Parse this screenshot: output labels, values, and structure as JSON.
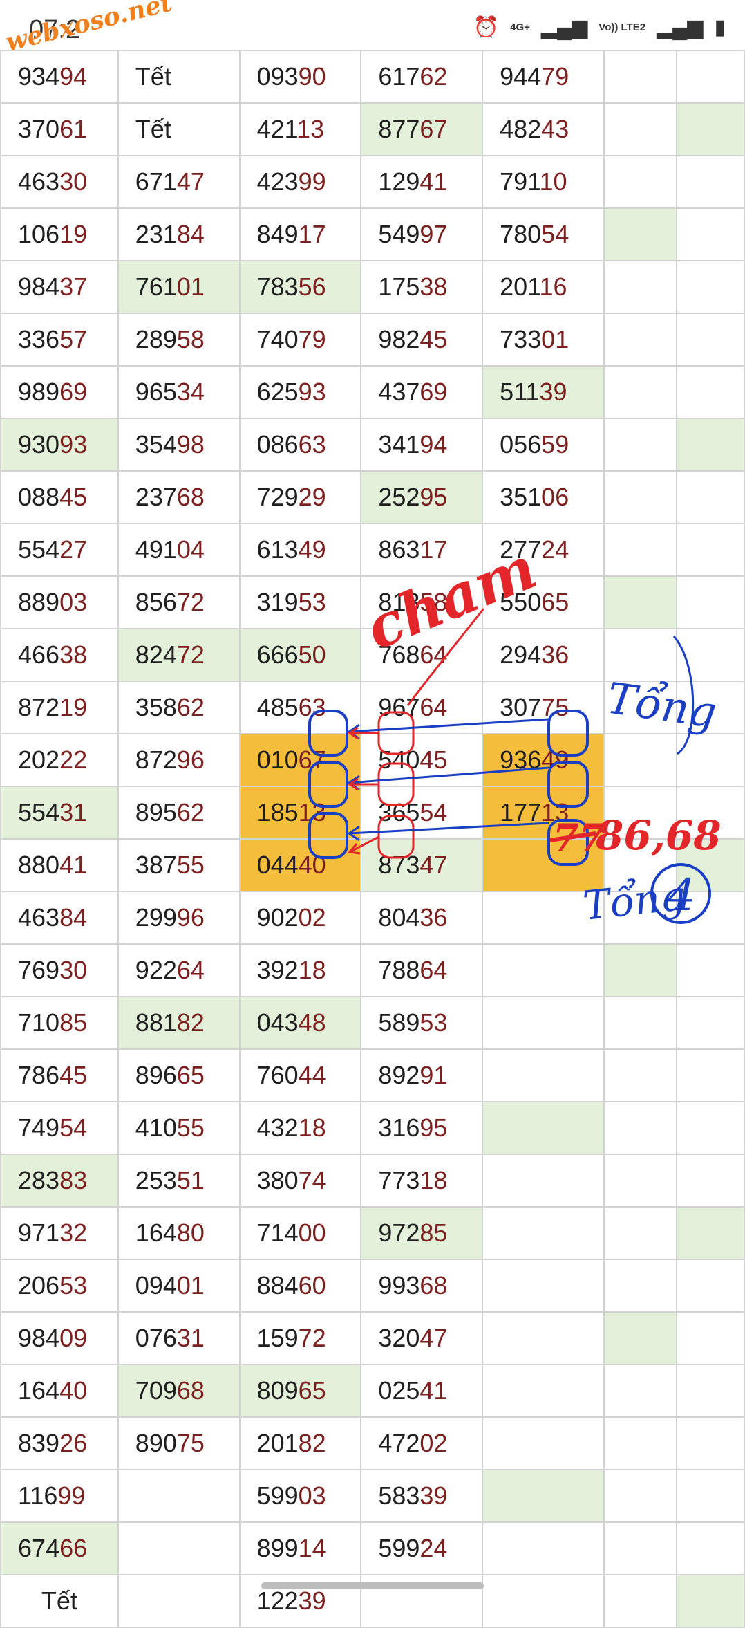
{
  "status": {
    "time": "07:2",
    "net": "4G+",
    "volte": "Vo)) LTE2"
  },
  "watermark": "webxoso.net",
  "table": {
    "rows": [
      [
        {
          "t": "93494",
          "p": "934",
          "s": "94"
        },
        {
          "t": "Tết"
        },
        {
          "t": "09390",
          "p": "093",
          "s": "90"
        },
        {
          "t": "61762",
          "p": "617",
          "s": "62"
        },
        {
          "t": "94479",
          "p": "944",
          "s": "79"
        },
        {
          "t": ""
        },
        {
          "t": ""
        }
      ],
      [
        {
          "t": "37061",
          "p": "370",
          "s": "61"
        },
        {
          "t": "Tết"
        },
        {
          "t": "42113",
          "p": "421",
          "s": "13"
        },
        {
          "t": "87767",
          "p": "877",
          "s": "67",
          "bg": "green"
        },
        {
          "t": "48243",
          "p": "482",
          "s": "43"
        },
        {
          "t": ""
        },
        {
          "t": "",
          "bg": "green"
        }
      ],
      [
        {
          "t": "46330",
          "p": "463",
          "s": "30"
        },
        {
          "t": "67147",
          "p": "671",
          "s": "47"
        },
        {
          "t": "42399",
          "p": "423",
          "s": "99"
        },
        {
          "t": "12941",
          "p": "129",
          "s": "41"
        },
        {
          "t": "79110",
          "p": "791",
          "s": "10"
        },
        {
          "t": ""
        },
        {
          "t": ""
        }
      ],
      [
        {
          "t": "10619",
          "p": "106",
          "s": "19"
        },
        {
          "t": "23184",
          "p": "231",
          "s": "84"
        },
        {
          "t": "84917",
          "p": "849",
          "s": "17"
        },
        {
          "t": "54997",
          "p": "549",
          "s": "97"
        },
        {
          "t": "78054",
          "p": "780",
          "s": "54"
        },
        {
          "t": "",
          "bg": "green"
        },
        {
          "t": ""
        }
      ],
      [
        {
          "t": "98437",
          "p": "984",
          "s": "37"
        },
        {
          "t": "76101",
          "p": "761",
          "s": "01",
          "bg": "green"
        },
        {
          "t": "78356",
          "p": "783",
          "s": "56",
          "bg": "green"
        },
        {
          "t": "17538",
          "p": "175",
          "s": "38"
        },
        {
          "t": "20116",
          "p": "201",
          "s": "16"
        },
        {
          "t": ""
        },
        {
          "t": ""
        }
      ],
      [
        {
          "t": "33657",
          "p": "336",
          "s": "57"
        },
        {
          "t": "28958",
          "p": "289",
          "s": "58"
        },
        {
          "t": "74079",
          "p": "740",
          "s": "79"
        },
        {
          "t": "98245",
          "p": "982",
          "s": "45"
        },
        {
          "t": "73301",
          "p": "733",
          "s": "01"
        },
        {
          "t": ""
        },
        {
          "t": ""
        }
      ],
      [
        {
          "t": "98969",
          "p": "989",
          "s": "69"
        },
        {
          "t": "96534",
          "p": "965",
          "s": "34"
        },
        {
          "t": "62593",
          "p": "625",
          "s": "93"
        },
        {
          "t": "43769",
          "p": "437",
          "s": "69"
        },
        {
          "t": "51139",
          "p": "511",
          "s": "39",
          "bg": "green"
        },
        {
          "t": ""
        },
        {
          "t": ""
        }
      ],
      [
        {
          "t": "93093",
          "p": "930",
          "s": "93",
          "bg": "green"
        },
        {
          "t": "35498",
          "p": "354",
          "s": "98"
        },
        {
          "t": "08663",
          "p": "086",
          "s": "63"
        },
        {
          "t": "34194",
          "p": "341",
          "s": "94"
        },
        {
          "t": "05659",
          "p": "056",
          "s": "59"
        },
        {
          "t": ""
        },
        {
          "t": "",
          "bg": "green"
        }
      ],
      [
        {
          "t": "08845",
          "p": "088",
          "s": "45"
        },
        {
          "t": "23768",
          "p": "237",
          "s": "68"
        },
        {
          "t": "72929",
          "p": "729",
          "s": "29"
        },
        {
          "t": "25295",
          "p": "252",
          "s": "95",
          "bg": "green"
        },
        {
          "t": "35106",
          "p": "351",
          "s": "06"
        },
        {
          "t": ""
        },
        {
          "t": ""
        }
      ],
      [
        {
          "t": "55427",
          "p": "554",
          "s": "27"
        },
        {
          "t": "49104",
          "p": "491",
          "s": "04"
        },
        {
          "t": "61349",
          "p": "613",
          "s": "49"
        },
        {
          "t": "86317",
          "p": "863",
          "s": "17"
        },
        {
          "t": "27724",
          "p": "277",
          "s": "24"
        },
        {
          "t": ""
        },
        {
          "t": ""
        }
      ],
      [
        {
          "t": "88903",
          "p": "889",
          "s": "03"
        },
        {
          "t": "85672",
          "p": "856",
          "s": "72"
        },
        {
          "t": "31953",
          "p": "319",
          "s": "53"
        },
        {
          "t": "81358",
          "p": "813",
          "s": "58"
        },
        {
          "t": "55065",
          "p": "550",
          "s": "65"
        },
        {
          "t": "",
          "bg": "green"
        },
        {
          "t": ""
        }
      ],
      [
        {
          "t": "46638",
          "p": "466",
          "s": "38"
        },
        {
          "t": "82472",
          "p": "824",
          "s": "72",
          "bg": "green"
        },
        {
          "t": "66650",
          "p": "666",
          "s": "50",
          "bg": "green"
        },
        {
          "t": "76864",
          "p": "768",
          "s": "64"
        },
        {
          "t": "29436",
          "p": "294",
          "s": "36"
        },
        {
          "t": ""
        },
        {
          "t": ""
        }
      ],
      [
        {
          "t": "87219",
          "p": "872",
          "s": "19"
        },
        {
          "t": "35862",
          "p": "358",
          "s": "62"
        },
        {
          "t": "48563",
          "p": "485",
          "s": "63"
        },
        {
          "t": "96764",
          "p": "967",
          "s": "64"
        },
        {
          "t": "30775",
          "p": "307",
          "s": "75"
        },
        {
          "t": ""
        },
        {
          "t": ""
        }
      ],
      [
        {
          "t": "20222",
          "p": "202",
          "s": "22"
        },
        {
          "t": "87296",
          "p": "872",
          "s": "96"
        },
        {
          "t": "01067",
          "p": "010",
          "s": "67",
          "bg": "orange"
        },
        {
          "t": "54045",
          "p": "540",
          "s": "45"
        },
        {
          "t": "93649",
          "p": "936",
          "s": "49",
          "bg": "orange"
        },
        {
          "t": ""
        },
        {
          "t": ""
        }
      ],
      [
        {
          "t": "55431",
          "p": "554",
          "s": "31",
          "bg": "green"
        },
        {
          "t": "89562",
          "p": "895",
          "s": "62"
        },
        {
          "t": "18513",
          "p": "185",
          "s": "13",
          "bg": "orange"
        },
        {
          "t": "36554",
          "p": "365",
          "s": "54"
        },
        {
          "t": "17713",
          "p": "177",
          "s": "13",
          "bg": "orange"
        },
        {
          "t": ""
        },
        {
          "t": ""
        }
      ],
      [
        {
          "t": "88041",
          "p": "880",
          "s": "41"
        },
        {
          "t": "38755",
          "p": "387",
          "s": "55"
        },
        {
          "t": "04440",
          "p": "044",
          "s": "40",
          "bg": "orange"
        },
        {
          "t": "87347",
          "p": "873",
          "s": "47",
          "bg": "green"
        },
        {
          "t": "",
          "bg": "orange"
        },
        {
          "t": ""
        },
        {
          "t": "",
          "bg": "green"
        }
      ],
      [
        {
          "t": "46384",
          "p": "463",
          "s": "84"
        },
        {
          "t": "29996",
          "p": "299",
          "s": "96"
        },
        {
          "t": "90202",
          "p": "902",
          "s": "02"
        },
        {
          "t": "80436",
          "p": "804",
          "s": "36"
        },
        {
          "t": ""
        },
        {
          "t": ""
        },
        {
          "t": ""
        }
      ],
      [
        {
          "t": "76930",
          "p": "769",
          "s": "30"
        },
        {
          "t": "92264",
          "p": "922",
          "s": "64"
        },
        {
          "t": "39218",
          "p": "392",
          "s": "18"
        },
        {
          "t": "78864",
          "p": "788",
          "s": "64"
        },
        {
          "t": ""
        },
        {
          "t": "",
          "bg": "green"
        },
        {
          "t": ""
        }
      ],
      [
        {
          "t": "71085",
          "p": "710",
          "s": "85"
        },
        {
          "t": "88182",
          "p": "881",
          "s": "82",
          "bg": "green"
        },
        {
          "t": "04348",
          "p": "043",
          "s": "48",
          "bg": "green"
        },
        {
          "t": "58953",
          "p": "589",
          "s": "53"
        },
        {
          "t": ""
        },
        {
          "t": ""
        },
        {
          "t": ""
        }
      ],
      [
        {
          "t": "78645",
          "p": "786",
          "s": "45"
        },
        {
          "t": "89665",
          "p": "896",
          "s": "65"
        },
        {
          "t": "76044",
          "p": "760",
          "s": "44"
        },
        {
          "t": "89291",
          "p": "892",
          "s": "91"
        },
        {
          "t": ""
        },
        {
          "t": ""
        },
        {
          "t": ""
        }
      ],
      [
        {
          "t": "74954",
          "p": "749",
          "s": "54"
        },
        {
          "t": "41055",
          "p": "410",
          "s": "55"
        },
        {
          "t": "43218",
          "p": "432",
          "s": "18"
        },
        {
          "t": "31695",
          "p": "316",
          "s": "95"
        },
        {
          "t": "",
          "bg": "green"
        },
        {
          "t": ""
        },
        {
          "t": ""
        }
      ],
      [
        {
          "t": "28383",
          "p": "283",
          "s": "83",
          "bg": "green"
        },
        {
          "t": "25351",
          "p": "253",
          "s": "51"
        },
        {
          "t": "38074",
          "p": "380",
          "s": "74"
        },
        {
          "t": "77318",
          "p": "773",
          "s": "18"
        },
        {
          "t": ""
        },
        {
          "t": ""
        },
        {
          "t": ""
        }
      ],
      [
        {
          "t": "97132",
          "p": "971",
          "s": "32"
        },
        {
          "t": "16480",
          "p": "164",
          "s": "80"
        },
        {
          "t": "71400",
          "p": "714",
          "s": "00"
        },
        {
          "t": "97285",
          "p": "972",
          "s": "85",
          "bg": "green"
        },
        {
          "t": ""
        },
        {
          "t": ""
        },
        {
          "t": "",
          "bg": "green"
        }
      ],
      [
        {
          "t": "20653",
          "p": "206",
          "s": "53"
        },
        {
          "t": "09401",
          "p": "094",
          "s": "01"
        },
        {
          "t": "88460",
          "p": "884",
          "s": "60"
        },
        {
          "t": "99368",
          "p": "993",
          "s": "68"
        },
        {
          "t": ""
        },
        {
          "t": ""
        },
        {
          "t": ""
        }
      ],
      [
        {
          "t": "98409",
          "p": "984",
          "s": "09"
        },
        {
          "t": "07631",
          "p": "076",
          "s": "31"
        },
        {
          "t": "15972",
          "p": "159",
          "s": "72"
        },
        {
          "t": "32047",
          "p": "320",
          "s": "47"
        },
        {
          "t": ""
        },
        {
          "t": "",
          "bg": "green"
        },
        {
          "t": ""
        }
      ],
      [
        {
          "t": "16440",
          "p": "164",
          "s": "40"
        },
        {
          "t": "70968",
          "p": "709",
          "s": "68",
          "bg": "green"
        },
        {
          "t": "80965",
          "p": "809",
          "s": "65",
          "bg": "green"
        },
        {
          "t": "02541",
          "p": "025",
          "s": "41"
        },
        {
          "t": ""
        },
        {
          "t": ""
        },
        {
          "t": ""
        }
      ],
      [
        {
          "t": "83926",
          "p": "839",
          "s": "26"
        },
        {
          "t": "89075",
          "p": "890",
          "s": "75"
        },
        {
          "t": "20182",
          "p": "201",
          "s": "82"
        },
        {
          "t": "47202",
          "p": "472",
          "s": "02"
        },
        {
          "t": ""
        },
        {
          "t": ""
        },
        {
          "t": ""
        }
      ],
      [
        {
          "t": "11699",
          "p": "116",
          "s": "99"
        },
        {
          "t": ""
        },
        {
          "t": "59903",
          "p": "599",
          "s": "03"
        },
        {
          "t": "58339",
          "p": "583",
          "s": "39"
        },
        {
          "t": "",
          "bg": "green"
        },
        {
          "t": ""
        },
        {
          "t": ""
        }
      ],
      [
        {
          "t": "67466",
          "p": "674",
          "s": "66",
          "bg": "green"
        },
        {
          "t": ""
        },
        {
          "t": "89914",
          "p": "899",
          "s": "14"
        },
        {
          "t": "59924",
          "p": "599",
          "s": "24"
        },
        {
          "t": ""
        },
        {
          "t": ""
        },
        {
          "t": ""
        }
      ],
      [
        {
          "t": "Tết",
          "center": true
        },
        {
          "t": ""
        },
        {
          "t": "12239",
          "p": "122",
          "s": "39"
        },
        {
          "t": ""
        },
        {
          "t": ""
        },
        {
          "t": ""
        },
        {
          "t": "",
          "bg": "green"
        }
      ]
    ]
  },
  "annotations": {
    "cham": "cham",
    "tong_top": "Tổng",
    "struck": "77",
    "numbers": "86,68",
    "tong_bottom": "Tổng",
    "circled": "4"
  }
}
